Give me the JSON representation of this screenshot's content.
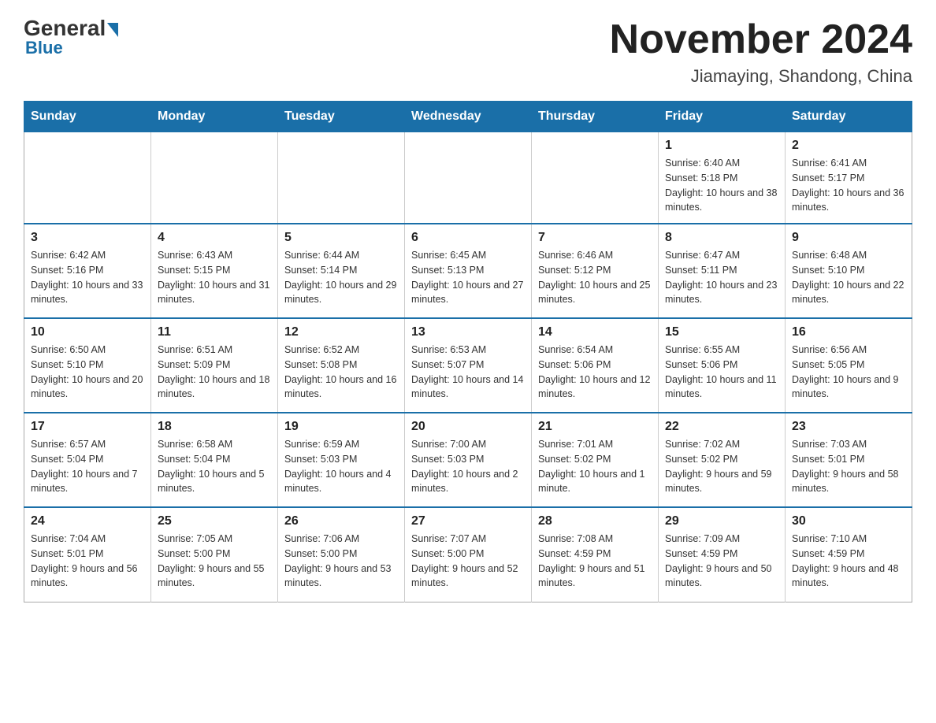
{
  "logo": {
    "top": "General",
    "bottom": "Blue"
  },
  "title": "November 2024",
  "subtitle": "Jiamaying, Shandong, China",
  "days_of_week": [
    "Sunday",
    "Monday",
    "Tuesday",
    "Wednesday",
    "Thursday",
    "Friday",
    "Saturday"
  ],
  "weeks": [
    [
      {
        "day": "",
        "info": ""
      },
      {
        "day": "",
        "info": ""
      },
      {
        "day": "",
        "info": ""
      },
      {
        "day": "",
        "info": ""
      },
      {
        "day": "",
        "info": ""
      },
      {
        "day": "1",
        "info": "Sunrise: 6:40 AM\nSunset: 5:18 PM\nDaylight: 10 hours and 38 minutes."
      },
      {
        "day": "2",
        "info": "Sunrise: 6:41 AM\nSunset: 5:17 PM\nDaylight: 10 hours and 36 minutes."
      }
    ],
    [
      {
        "day": "3",
        "info": "Sunrise: 6:42 AM\nSunset: 5:16 PM\nDaylight: 10 hours and 33 minutes."
      },
      {
        "day": "4",
        "info": "Sunrise: 6:43 AM\nSunset: 5:15 PM\nDaylight: 10 hours and 31 minutes."
      },
      {
        "day": "5",
        "info": "Sunrise: 6:44 AM\nSunset: 5:14 PM\nDaylight: 10 hours and 29 minutes."
      },
      {
        "day": "6",
        "info": "Sunrise: 6:45 AM\nSunset: 5:13 PM\nDaylight: 10 hours and 27 minutes."
      },
      {
        "day": "7",
        "info": "Sunrise: 6:46 AM\nSunset: 5:12 PM\nDaylight: 10 hours and 25 minutes."
      },
      {
        "day": "8",
        "info": "Sunrise: 6:47 AM\nSunset: 5:11 PM\nDaylight: 10 hours and 23 minutes."
      },
      {
        "day": "9",
        "info": "Sunrise: 6:48 AM\nSunset: 5:10 PM\nDaylight: 10 hours and 22 minutes."
      }
    ],
    [
      {
        "day": "10",
        "info": "Sunrise: 6:50 AM\nSunset: 5:10 PM\nDaylight: 10 hours and 20 minutes."
      },
      {
        "day": "11",
        "info": "Sunrise: 6:51 AM\nSunset: 5:09 PM\nDaylight: 10 hours and 18 minutes."
      },
      {
        "day": "12",
        "info": "Sunrise: 6:52 AM\nSunset: 5:08 PM\nDaylight: 10 hours and 16 minutes."
      },
      {
        "day": "13",
        "info": "Sunrise: 6:53 AM\nSunset: 5:07 PM\nDaylight: 10 hours and 14 minutes."
      },
      {
        "day": "14",
        "info": "Sunrise: 6:54 AM\nSunset: 5:06 PM\nDaylight: 10 hours and 12 minutes."
      },
      {
        "day": "15",
        "info": "Sunrise: 6:55 AM\nSunset: 5:06 PM\nDaylight: 10 hours and 11 minutes."
      },
      {
        "day": "16",
        "info": "Sunrise: 6:56 AM\nSunset: 5:05 PM\nDaylight: 10 hours and 9 minutes."
      }
    ],
    [
      {
        "day": "17",
        "info": "Sunrise: 6:57 AM\nSunset: 5:04 PM\nDaylight: 10 hours and 7 minutes."
      },
      {
        "day": "18",
        "info": "Sunrise: 6:58 AM\nSunset: 5:04 PM\nDaylight: 10 hours and 5 minutes."
      },
      {
        "day": "19",
        "info": "Sunrise: 6:59 AM\nSunset: 5:03 PM\nDaylight: 10 hours and 4 minutes."
      },
      {
        "day": "20",
        "info": "Sunrise: 7:00 AM\nSunset: 5:03 PM\nDaylight: 10 hours and 2 minutes."
      },
      {
        "day": "21",
        "info": "Sunrise: 7:01 AM\nSunset: 5:02 PM\nDaylight: 10 hours and 1 minute."
      },
      {
        "day": "22",
        "info": "Sunrise: 7:02 AM\nSunset: 5:02 PM\nDaylight: 9 hours and 59 minutes."
      },
      {
        "day": "23",
        "info": "Sunrise: 7:03 AM\nSunset: 5:01 PM\nDaylight: 9 hours and 58 minutes."
      }
    ],
    [
      {
        "day": "24",
        "info": "Sunrise: 7:04 AM\nSunset: 5:01 PM\nDaylight: 9 hours and 56 minutes."
      },
      {
        "day": "25",
        "info": "Sunrise: 7:05 AM\nSunset: 5:00 PM\nDaylight: 9 hours and 55 minutes."
      },
      {
        "day": "26",
        "info": "Sunrise: 7:06 AM\nSunset: 5:00 PM\nDaylight: 9 hours and 53 minutes."
      },
      {
        "day": "27",
        "info": "Sunrise: 7:07 AM\nSunset: 5:00 PM\nDaylight: 9 hours and 52 minutes."
      },
      {
        "day": "28",
        "info": "Sunrise: 7:08 AM\nSunset: 4:59 PM\nDaylight: 9 hours and 51 minutes."
      },
      {
        "day": "29",
        "info": "Sunrise: 7:09 AM\nSunset: 4:59 PM\nDaylight: 9 hours and 50 minutes."
      },
      {
        "day": "30",
        "info": "Sunrise: 7:10 AM\nSunset: 4:59 PM\nDaylight: 9 hours and 48 minutes."
      }
    ]
  ]
}
